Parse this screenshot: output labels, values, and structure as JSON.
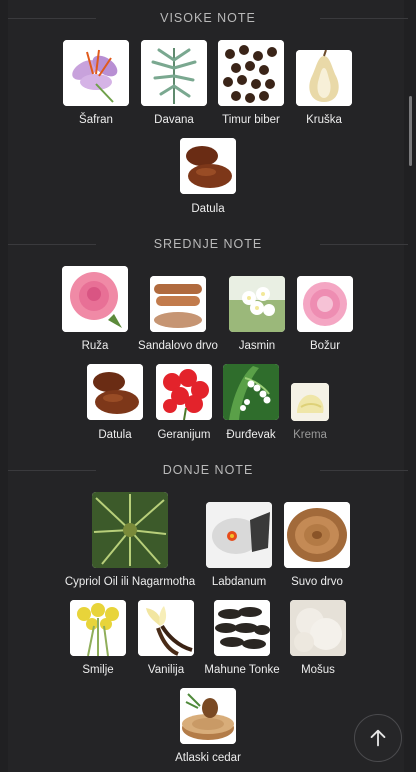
{
  "sections": {
    "top": "VISOKE NOTE",
    "middle": "SREDNJE NOTE",
    "base": "DONJE NOTE"
  },
  "notes": {
    "top": [
      "Šafran",
      "Davana",
      "Timur biber",
      "Kruška",
      "Datula"
    ],
    "middle": [
      "Ruža",
      "Sandalovo drvo",
      "Jasmin",
      "Božur",
      "Datula",
      "Geranijum",
      "Đurđevak",
      "Krema"
    ],
    "base": [
      "Cypriol Oil ili Nagarmotha",
      "Labdanum",
      "Suvo drvo",
      "Smilje",
      "Vanilija",
      "Mahune Tonke",
      "Mošus",
      "Atlaski cedar"
    ]
  },
  "icons": {
    "scroll_top": "arrow-up-icon"
  }
}
